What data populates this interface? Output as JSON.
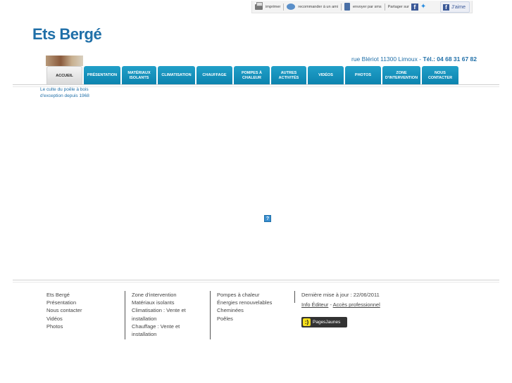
{
  "utility_bar": {
    "print_label": "imprimer",
    "recommend_label": "recommander à un ami",
    "sms_label": "envoyer par sms",
    "share_label": "Partager sur",
    "like_label": "J'aime"
  },
  "site": {
    "title": "Ets Bergé",
    "address": "rue Blériot 11300 Limoux -",
    "tel": "Tél.: 04 68 31 67 82",
    "tagline": "Le culte du poêle à bois d'exception depuis 1968"
  },
  "nav": [
    "ACCUEIL",
    "PRÉSENTATION",
    "MATÉRIAUX ISOLANTS",
    "CLIMATISATION",
    "CHAUFFAGE",
    "POMPES À CHALEUR",
    "AUTRES ACTIVITÉS",
    "VIDÉOS",
    "PHOTOS",
    "ZONE D'INTERVENTION",
    "NOUS CONTACTER"
  ],
  "footer": {
    "col1": [
      "Ets Bergé",
      "Présentation",
      "Nous contacter",
      "Vidéos",
      "Photos"
    ],
    "col2": [
      "Zone d'intervention",
      "Matériaux isolants",
      "Climatisation : Vente et installation",
      "Chauffage : Vente et installation"
    ],
    "col3": [
      "Pompes à chaleur",
      "Énergies renouvelables",
      "Cheminées",
      "Poêles"
    ],
    "last_update": "Dernière mise à jour : 22/06/2011",
    "info_editeur": "Info Éditeur",
    "dash": "-",
    "acces_pro": "Accès professionnel",
    "pagesjaunes": "PagesJaunes"
  }
}
